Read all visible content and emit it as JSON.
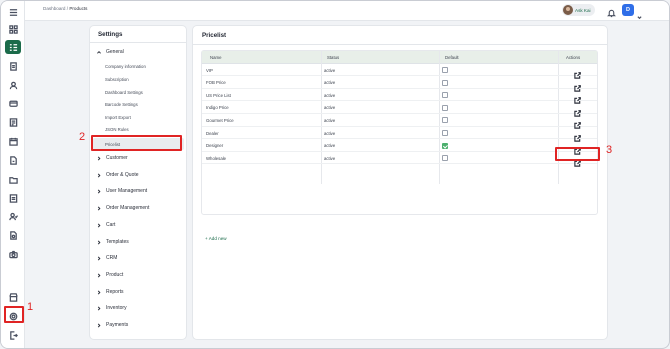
{
  "topbar": {
    "breadcrumb_root": "Dashboard",
    "breadcrumb_sep": "/",
    "breadcrumb_current": "Products",
    "user_name": "Ask Kai",
    "account_initial": "D"
  },
  "rail_icons": [
    "menu-icon",
    "dashboard-icon",
    "products-icon",
    "orders-icon",
    "customers-icon",
    "payments-icon",
    "catalog-icon",
    "calendar-icon",
    "quotes-icon",
    "documents-icon",
    "folder-icon",
    "reports-icon",
    "users-icon",
    "files-icon",
    "camera-icon",
    "store-icon",
    "settings-icon",
    "logout-icon"
  ],
  "settings": {
    "title": "Settings",
    "general_label": "General",
    "general_items": [
      "Company information",
      "Subscription",
      "Dashboard Settings",
      "Barcode Settings",
      "Import Export",
      "JSON Rules",
      "Pricelist"
    ],
    "selected_item": "Pricelist",
    "groups": [
      "Customer",
      "Order & Quote",
      "User Management",
      "Order Management",
      "Cart",
      "Templates",
      "CRM",
      "Product",
      "Reports",
      "Inventory",
      "Payments"
    ]
  },
  "pricelist": {
    "title": "Pricelist",
    "columns": [
      "Name",
      "Status",
      "Default",
      "Actions"
    ],
    "rows": [
      {
        "name": "VIP",
        "status": "active",
        "default": false
      },
      {
        "name": "FOB Price",
        "status": "active",
        "default": false
      },
      {
        "name": "US Price List",
        "status": "active",
        "default": false
      },
      {
        "name": "Indigo Price",
        "status": "active",
        "default": false
      },
      {
        "name": "Gourmet Price",
        "status": "active",
        "default": false
      },
      {
        "name": "Dealer",
        "status": "active",
        "default": false
      },
      {
        "name": "Designer",
        "status": "active",
        "default": true
      },
      {
        "name": "Wholesale",
        "status": "active",
        "default": false
      }
    ],
    "add_new_label": "+ Add new"
  },
  "annotations": [
    "1",
    "2",
    "3"
  ],
  "colors": {
    "brand_green": "#1b6b4a",
    "highlight_red": "#e02424",
    "account_blue": "#2f6ee8",
    "checked_green": "#4caf6d"
  }
}
